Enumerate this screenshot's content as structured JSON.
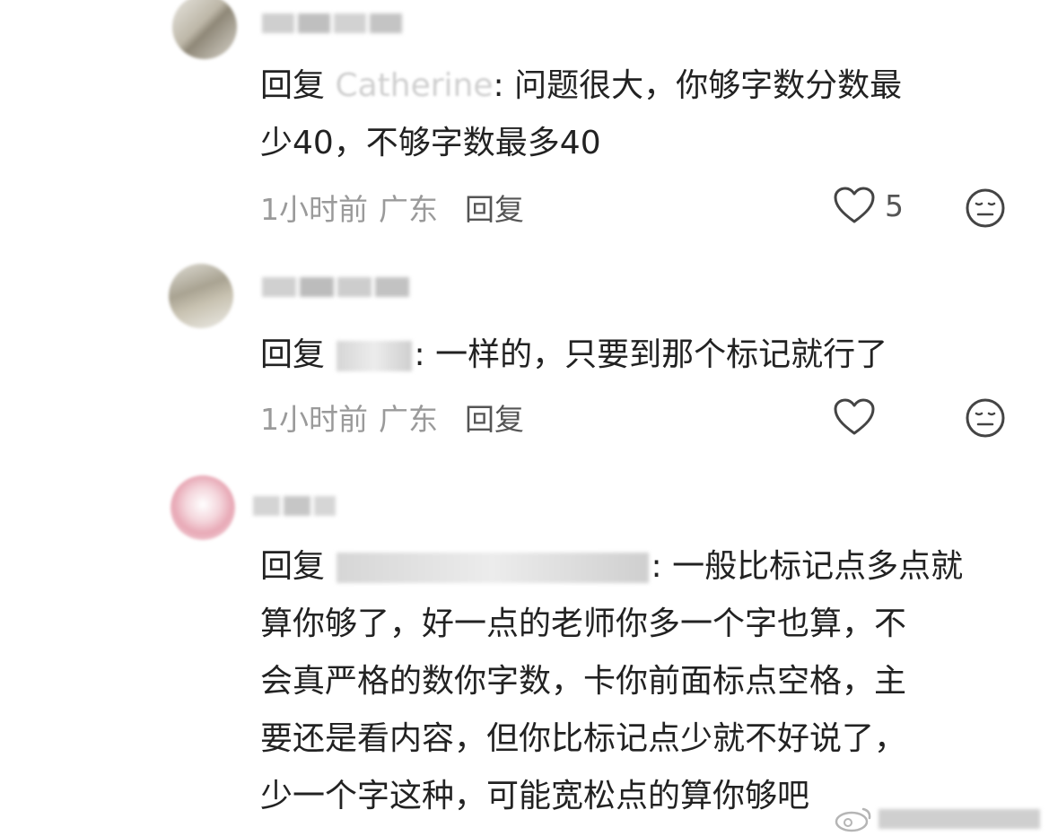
{
  "comments": [
    {
      "reply_prefix": "回复",
      "reply_to": "Catherine",
      "separator": ":",
      "lines": [
        "问题很大，你够字数分数最",
        "少40，不够字数最多40"
      ],
      "time": "1小时前",
      "location": "广东",
      "reply_label": "回复",
      "like_count": "5"
    },
    {
      "reply_prefix": "回复",
      "separator": ":",
      "lines": [
        "一样的，只要到那个标记就行了"
      ],
      "time": "1小时前",
      "location": "广东",
      "reply_label": "回复",
      "like_count": ""
    },
    {
      "reply_prefix": "回复",
      "separator": ":",
      "lines": [
        "一般比标记点多点就",
        "算你够了，好一点的老师你多一个字也算，不",
        "会真严格的数你字数，卡你前面标点空格，主",
        "要还是看内容，但你比标记点少就不好说了，",
        "少一个字这种，可能宽松点的算你够吧"
      ]
    }
  ],
  "icons": {
    "like": "heart-outline-icon",
    "dislike": "meh-face-icon",
    "watermark": "weibo-icon"
  },
  "colors": {
    "text": "#222222",
    "meta": "#9a9a9a",
    "icon": "#444444"
  }
}
